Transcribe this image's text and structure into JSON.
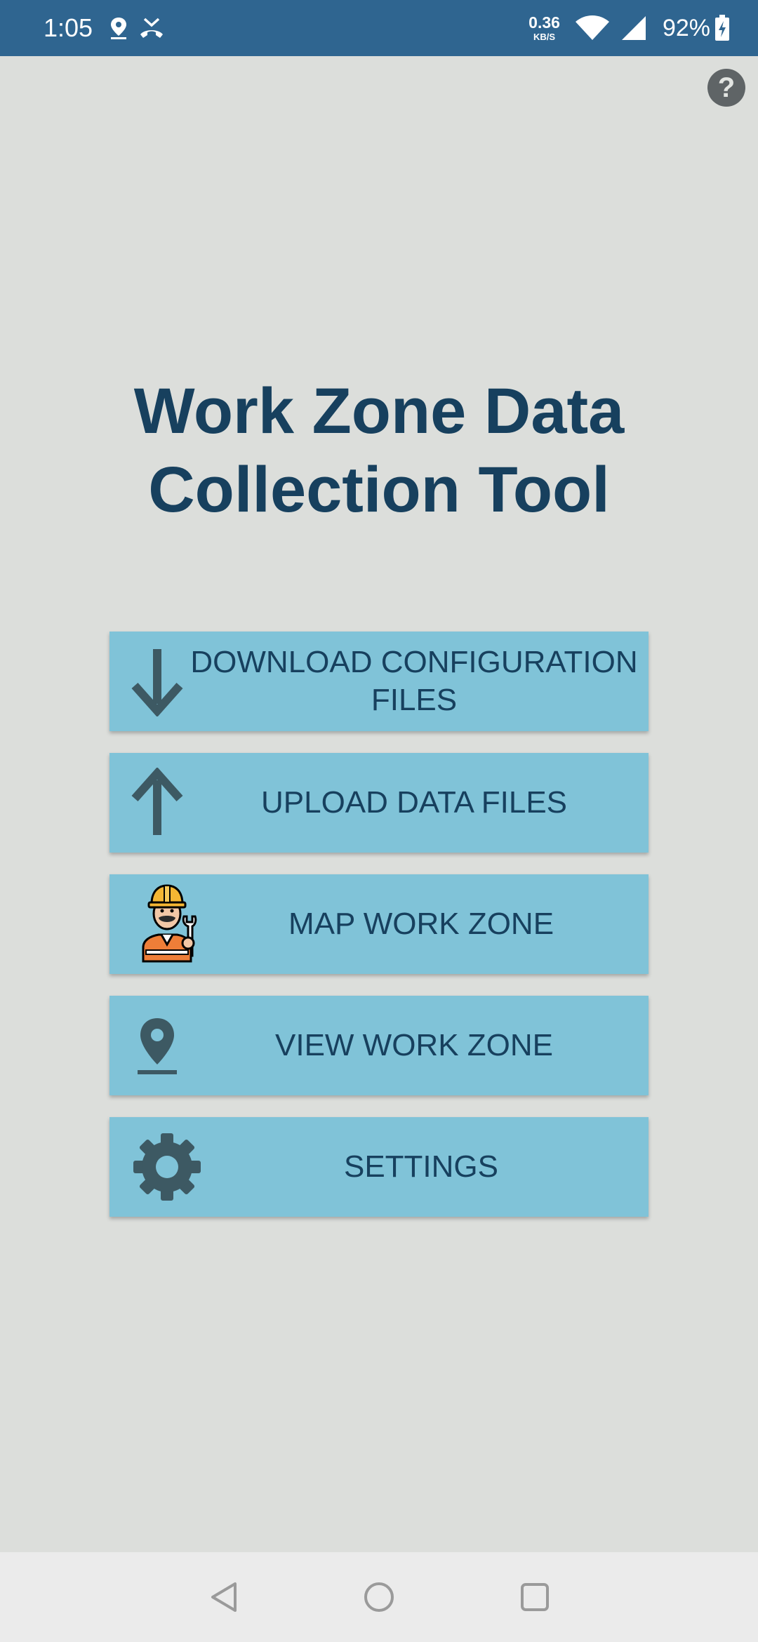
{
  "status_bar": {
    "time": "1:05",
    "net_speed_value": "0.36",
    "net_speed_unit": "KB/S",
    "battery_percent": "92%",
    "icons": [
      "location-icon",
      "missed-call-icon",
      "wifi-icon",
      "signal-icon",
      "battery-charging-icon"
    ]
  },
  "help": {
    "label": "?"
  },
  "app": {
    "title_line1": "Work Zone Data",
    "title_line2": "Collection Tool"
  },
  "menu": {
    "download_line1": "DOWNLOAD CONFIGURATION",
    "download_line2": "FILES",
    "upload": "UPLOAD DATA FILES",
    "map": "MAP WORK ZONE",
    "view": "VIEW WORK ZONE",
    "settings": "SETTINGS"
  },
  "colors": {
    "status_bar": "#2f6590",
    "background": "#dcdedb",
    "button": "#80c3d8",
    "text": "#17405e",
    "icon": "#3d5963"
  }
}
